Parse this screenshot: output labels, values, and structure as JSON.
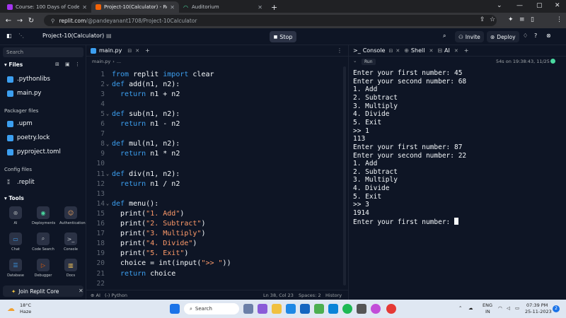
{
  "browser": {
    "tabs": [
      {
        "label": "Course: 100 Days of Code: The C",
        "active": false
      },
      {
        "label": "Project-10(Calculator) - Replit",
        "active": true
      },
      {
        "label": "Auditorium",
        "active": false
      }
    ],
    "url_host": "replit.com",
    "url_path": "/@pandeyanant1708/Project-10Calculator"
  },
  "header": {
    "project_name": "Project-10(Calculator)",
    "stop_label": "Stop",
    "invite_label": "Invite",
    "deploy_label": "Deploy"
  },
  "sidebar": {
    "search_placeholder": "Search",
    "files_title": "Files",
    "files": [
      ".pythonlibs",
      "main.py"
    ],
    "packager_title": "Packager files",
    "packager_files": [
      ".upm",
      "poetry.lock",
      "pyproject.toml"
    ],
    "config_title": "Config files",
    "config_files": [
      ".replit"
    ],
    "tools_title": "Tools",
    "tools": [
      "AI",
      "Deployments",
      "Authentication",
      "Chat",
      "Code Search",
      "Console",
      "Database",
      "Debugger",
      "Docs"
    ],
    "core_label": "Join Replit Core"
  },
  "editor": {
    "tab_label": "main.py",
    "breadcrumb": "main.py",
    "breadcrumb_more": "...",
    "status_ai": "AI",
    "status_lang": "(-) Python",
    "status_pos": "Ln 38, Col 23",
    "status_spaces": "Spaces: 2",
    "status_history": "History",
    "lines": [
      {
        "n": "1",
        "fold": false,
        "tokens": [
          [
            "kw",
            "from"
          ],
          [
            "fn",
            " replit "
          ],
          [
            "kw",
            "import"
          ],
          [
            "fn",
            " clear"
          ]
        ]
      },
      {
        "n": "2",
        "fold": true,
        "tokens": [
          [
            "kw",
            "def"
          ],
          [
            "fn",
            " add(n1, n2):"
          ]
        ]
      },
      {
        "n": "3",
        "fold": false,
        "tokens": [
          [
            "kw",
            "  return"
          ],
          [
            "fn",
            " n1 + n2"
          ]
        ]
      },
      {
        "n": "4",
        "fold": false,
        "tokens": []
      },
      {
        "n": "5",
        "fold": true,
        "tokens": [
          [
            "kw",
            "def"
          ],
          [
            "fn",
            " sub(n1, n2):"
          ]
        ]
      },
      {
        "n": "6",
        "fold": false,
        "tokens": [
          [
            "kw",
            "  return"
          ],
          [
            "fn",
            " n1 - n2"
          ]
        ]
      },
      {
        "n": "7",
        "fold": false,
        "tokens": []
      },
      {
        "n": "8",
        "fold": true,
        "tokens": [
          [
            "kw",
            "def"
          ],
          [
            "fn",
            " mul(n1, n2):"
          ]
        ]
      },
      {
        "n": "9",
        "fold": false,
        "tokens": [
          [
            "kw",
            "  return"
          ],
          [
            "fn",
            " n1 * n2"
          ]
        ]
      },
      {
        "n": "10",
        "fold": false,
        "tokens": []
      },
      {
        "n": "11",
        "fold": true,
        "tokens": [
          [
            "kw",
            "def"
          ],
          [
            "fn",
            " div(n1, n2):"
          ]
        ]
      },
      {
        "n": "12",
        "fold": false,
        "tokens": [
          [
            "kw",
            "  return"
          ],
          [
            "fn",
            " n1 / n2"
          ]
        ]
      },
      {
        "n": "13",
        "fold": false,
        "tokens": []
      },
      {
        "n": "14",
        "fold": true,
        "tokens": [
          [
            "kw",
            "def"
          ],
          [
            "fn",
            " menu():"
          ]
        ]
      },
      {
        "n": "15",
        "fold": false,
        "tokens": [
          [
            "fn",
            "  print("
          ],
          [
            "str",
            "\"1. Add\""
          ],
          [
            "fn",
            ")"
          ]
        ]
      },
      {
        "n": "16",
        "fold": false,
        "tokens": [
          [
            "fn",
            "  print("
          ],
          [
            "str",
            "\"2. Subtract\""
          ],
          [
            "fn",
            ")"
          ]
        ]
      },
      {
        "n": "17",
        "fold": false,
        "tokens": [
          [
            "fn",
            "  print("
          ],
          [
            "str",
            "\"3. Multiply\""
          ],
          [
            "fn",
            ")"
          ]
        ]
      },
      {
        "n": "18",
        "fold": false,
        "tokens": [
          [
            "fn",
            "  print("
          ],
          [
            "str",
            "\"4. Divide\""
          ],
          [
            "fn",
            ")"
          ]
        ]
      },
      {
        "n": "19",
        "fold": false,
        "tokens": [
          [
            "fn",
            "  print("
          ],
          [
            "str",
            "\"5. Exit\""
          ],
          [
            "fn",
            ")"
          ]
        ]
      },
      {
        "n": "20",
        "fold": false,
        "tokens": [
          [
            "fn",
            "  choice = int(input("
          ],
          [
            "str",
            "\">> \""
          ],
          [
            "fn",
            "))"
          ]
        ]
      },
      {
        "n": "21",
        "fold": false,
        "tokens": [
          [
            "kw",
            "  return"
          ],
          [
            "fn",
            " choice"
          ]
        ]
      },
      {
        "n": "22",
        "fold": false,
        "tokens": []
      }
    ]
  },
  "console": {
    "tabs": [
      "Console",
      "Shell",
      "AI"
    ],
    "run_label": "Run",
    "run_info": "54s on 19:38:43, 11/25",
    "output": [
      "Enter your first number: 45",
      "Enter your second number: 68",
      "1. Add",
      "2. Subtract",
      "3. Multiply",
      "4. Divide",
      "5. Exit",
      ">> 1",
      "113",
      "Enter your first number: 87",
      "Enter your second number: 22",
      "1. Add",
      "2. Subtract",
      "3. Multiply",
      "4. Divide",
      "5. Exit",
      ">> 3",
      "1914",
      "Enter your first number: "
    ]
  },
  "taskbar": {
    "weather_temp": "18°C",
    "weather_desc": "Haze",
    "search_label": "Search",
    "lang_1": "ENG",
    "lang_2": "IN",
    "time": "07:39 PM",
    "date": "25-11-2023",
    "notif_count": "2"
  },
  "colors": {
    "bg": "#0e1525",
    "keyword": "#3c9ff0",
    "string": "#ff9b6a",
    "accent": "#0079f2"
  }
}
